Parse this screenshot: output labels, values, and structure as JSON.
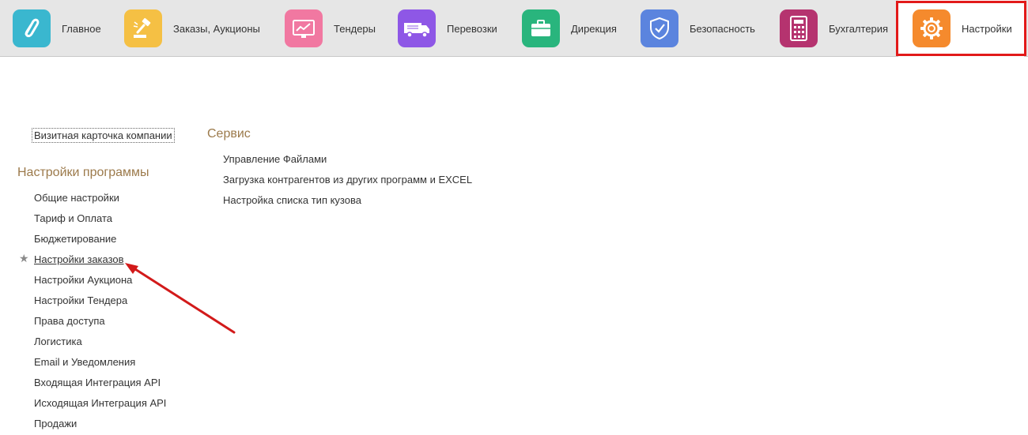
{
  "top_tabs": [
    {
      "label": "Главное",
      "icon": "swirl-logo-icon",
      "color": "#3ab7cf"
    },
    {
      "label": "Заказы, Аукционы",
      "icon": "gavel-icon",
      "color": "#f5c044"
    },
    {
      "label": "Тендеры",
      "icon": "line-chart-monitor-icon",
      "color": "#f178a1"
    },
    {
      "label": "Перевозки",
      "icon": "truck-icon",
      "color": "#8e57e6"
    },
    {
      "label": "Дирекция",
      "icon": "briefcase-icon",
      "color": "#29b57d"
    },
    {
      "label": "Безопасность",
      "icon": "shield-check-icon",
      "color": "#5b84de"
    },
    {
      "label": "Бухгалтерия",
      "icon": "calculator-icon",
      "color": "#b5336f"
    },
    {
      "label": "Настройки",
      "icon": "gear-icon",
      "color": "#f58a2d",
      "active": true
    }
  ],
  "company_card": "Визитная карточка компании",
  "program_settings": {
    "title": "Настройки программы",
    "items": [
      "Общие настройки",
      "Тариф и Оплата",
      "Бюджетирование",
      "Настройки заказов",
      "Настройки Аукциона",
      "Настройки Тендера",
      "Права доступа",
      "Логистика",
      "Email и Уведомления",
      "Входящая Интеграция API",
      "Исходящая Интеграция API",
      "Продажи"
    ],
    "starred": "Настройки заказов"
  },
  "service": {
    "title": "Сервис",
    "items": [
      "Управление Файлами",
      "Загрузка контрагентов из других программ и EXCEL",
      "Настройка списка тип кузова"
    ]
  },
  "colors": {
    "section_title": "#9c7a4b",
    "highlight_frame": "#e21a1a",
    "annotation_arrow": "#d21a1a"
  }
}
